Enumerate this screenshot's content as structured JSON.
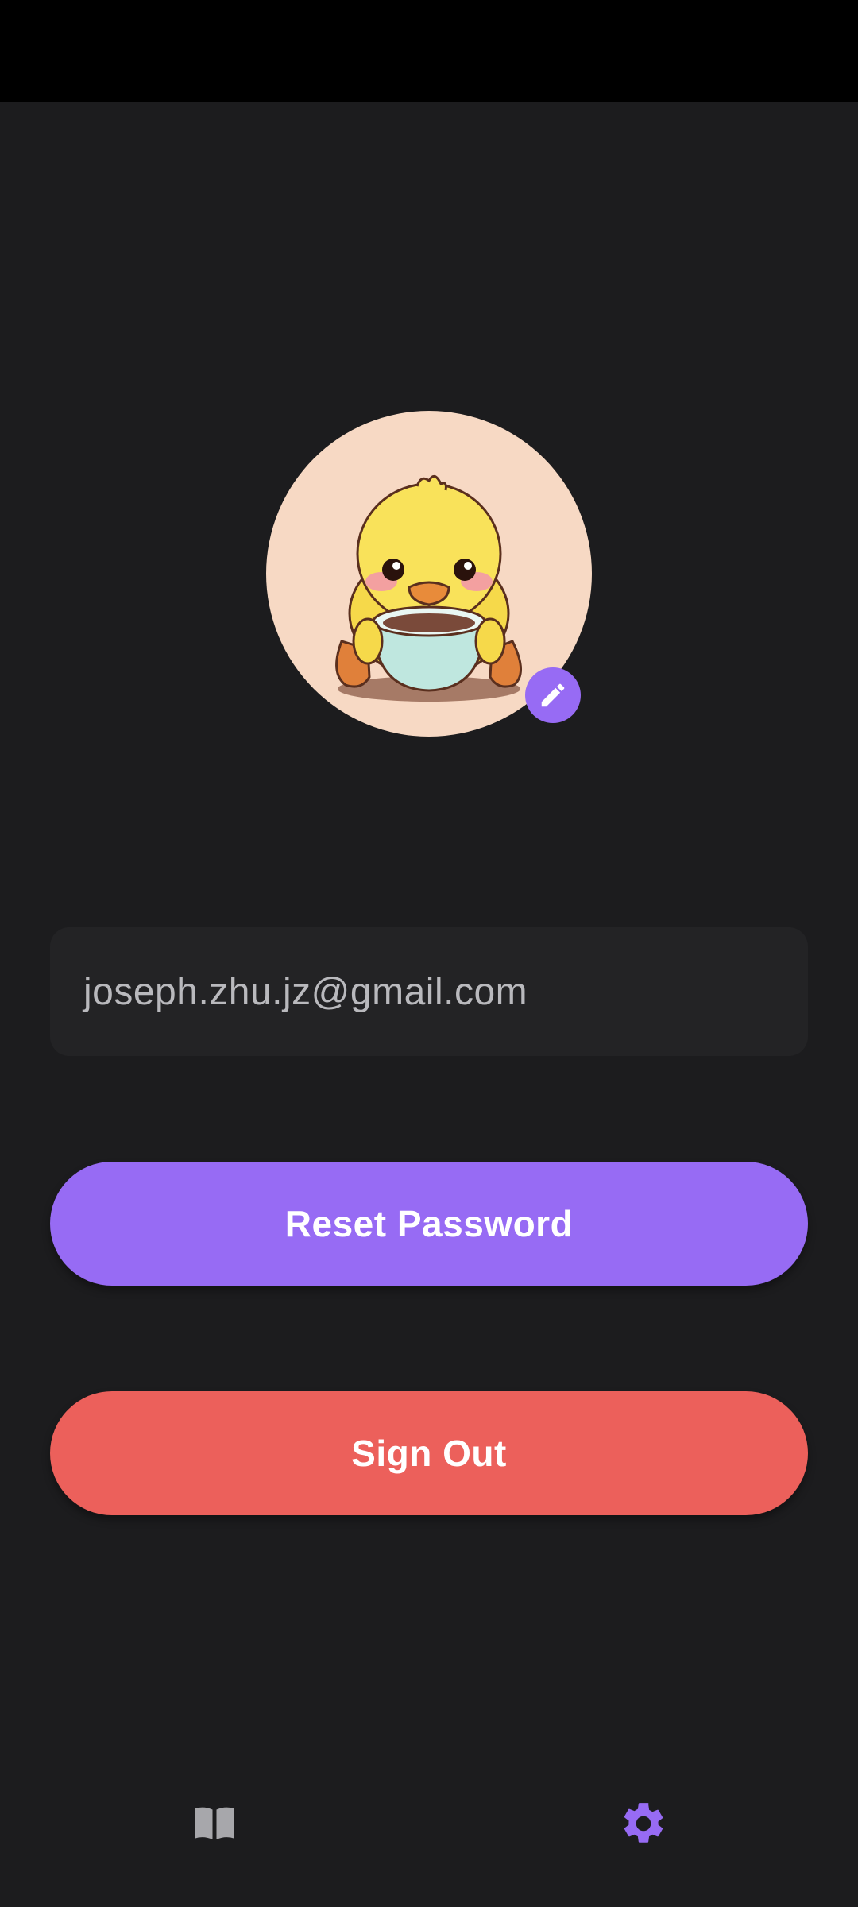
{
  "profile": {
    "email": "joseph.zhu.jz@gmail.com",
    "avatar_icon": "duck-with-teacup-avatar",
    "edit_icon": "pencil-icon"
  },
  "actions": {
    "reset_password_label": "Reset Password",
    "sign_out_label": "Sign Out"
  },
  "bottom_nav": {
    "items": [
      {
        "icon": "book-icon",
        "active": false
      },
      {
        "icon": "gear-icon",
        "active": true
      }
    ]
  },
  "colors": {
    "background": "#1c1c1e",
    "status_bar": "#000000",
    "accent": "#976bf4",
    "danger": "#ec605b",
    "field_bg": "#232325",
    "inactive_icon": "#a7a7ab",
    "avatar_bg": "#f7d9c4"
  }
}
